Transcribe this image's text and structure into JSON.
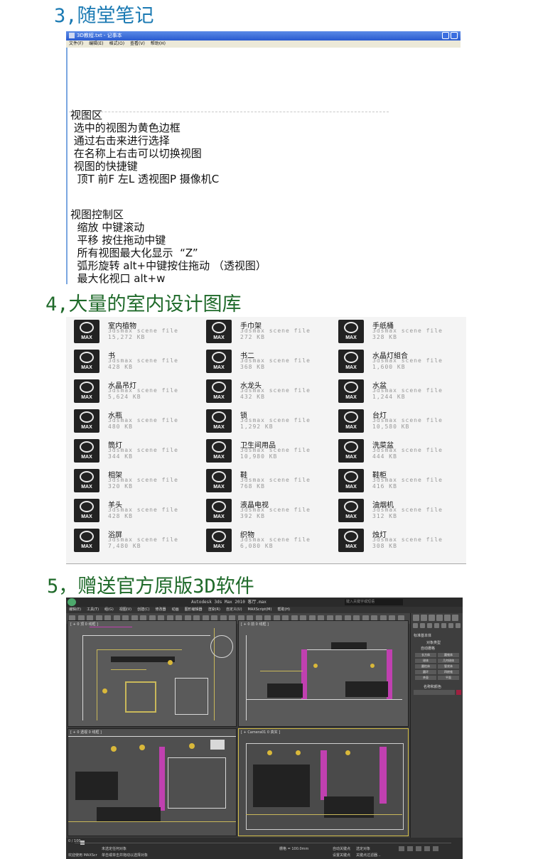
{
  "headings": {
    "h3": "3,随堂笔记",
    "h4": "4,大量的室内设计图库",
    "h5": "5，赠送官方原版3D软件"
  },
  "notepad": {
    "title": "3D教程.txt - 记事本",
    "menu": [
      "文件(F)",
      "编辑(E)",
      "格式(O)",
      "查看(V)",
      "帮助(H)"
    ],
    "lines": [
      "视图区",
      " 选中的视图为黄色边框",
      " 通过右击来进行选择",
      " 在名称上右击可以切换视图",
      " 视图的快捷键",
      "  顶T 前F 左L 透视图P 摄像机C",
      "",
      "",
      "视图控制区",
      "  缩放 中键滚动",
      "  平移 按住拖动中键",
      "  所有视图最大化显示  “Z”",
      "  弧形旋转 alt+中键按住拖动 （透视图）",
      "  最大化视口 alt+w"
    ]
  },
  "library": {
    "icon_label": "MAX",
    "file_type": "3dsmax scene file",
    "files": [
      {
        "name": "室内植物",
        "size": "15,272 KB"
      },
      {
        "name": "手巾架",
        "size": "272 KB"
      },
      {
        "name": "手纸桶",
        "size": "328 KB"
      },
      {
        "name": "书",
        "size": "428 KB"
      },
      {
        "name": "书二",
        "size": "368 KB"
      },
      {
        "name": "水晶灯組合",
        "size": "1,600 KB"
      },
      {
        "name": "水晶吊灯",
        "size": "5,624 KB"
      },
      {
        "name": "水龙头",
        "size": "432 KB"
      },
      {
        "name": "水盆",
        "size": "1,244 KB"
      },
      {
        "name": "水瓶",
        "size": "480 KB"
      },
      {
        "name": "锁",
        "size": "1,292 KB"
      },
      {
        "name": "台灯",
        "size": "10,580 KB"
      },
      {
        "name": "筒灯",
        "size": "344 KB"
      },
      {
        "name": "卫生间用品",
        "size": "10,980 KB"
      },
      {
        "name": "洗菜盆",
        "size": "444 KB"
      },
      {
        "name": "相架",
        "size": "320 KB"
      },
      {
        "name": "鞋",
        "size": "768 KB"
      },
      {
        "name": "鞋柜",
        "size": "416 KB"
      },
      {
        "name": "羊头",
        "size": "428 KB"
      },
      {
        "name": "液晶电视",
        "size": "392 KB"
      },
      {
        "name": "油烟机",
        "size": "312 KB"
      },
      {
        "name": "浴屏",
        "size": "7,480 KB"
      },
      {
        "name": "织物",
        "size": "6,080 KB"
      },
      {
        "name": "烛灯",
        "size": "308 KB"
      }
    ]
  },
  "max": {
    "title": "Autodesk 3ds Max 2010    客厅.max",
    "search_placeholder": "键入关键字或短语",
    "menu": [
      "编辑(E)",
      "工具(T)",
      "组(G)",
      "视图(V)",
      "创建(C)",
      "修改器",
      "动画",
      "图形编辑器",
      "渲染(R)",
      "自定义(U)",
      "MAXScript(M)",
      "帮助(H)"
    ],
    "viewports": {
      "top": "[ + 0 顶 0 线框 ]",
      "front": "[ + 0 前 0 线框 ]",
      "left": "[ + 0 透视 0 线框 ]",
      "camera": "[ + Camera01 0 真实 ]"
    },
    "panel": {
      "dropdown": "标准基本体",
      "rollout": "对象类型",
      "autogrid": "自动栅格",
      "buttons": [
        "长方体",
        "圆锥体",
        "球体",
        "几何球体",
        "圆柱体",
        "管状体",
        "圆环",
        "四棱锥",
        "茶壶",
        "平面"
      ],
      "name_color": "名称和颜色"
    },
    "status": {
      "frames": "0 / 100",
      "hint1": "未选定任何对象",
      "hint2": "单击或单击并拖动以选择对象",
      "grid": "栅格 = 100.0mm",
      "autokey": "自动关键点",
      "selected": "选定对象",
      "setkey": "设置关键点",
      "filter": "关键点过滤器...",
      "welcome": "欢迎使用 MAXScr"
    }
  }
}
